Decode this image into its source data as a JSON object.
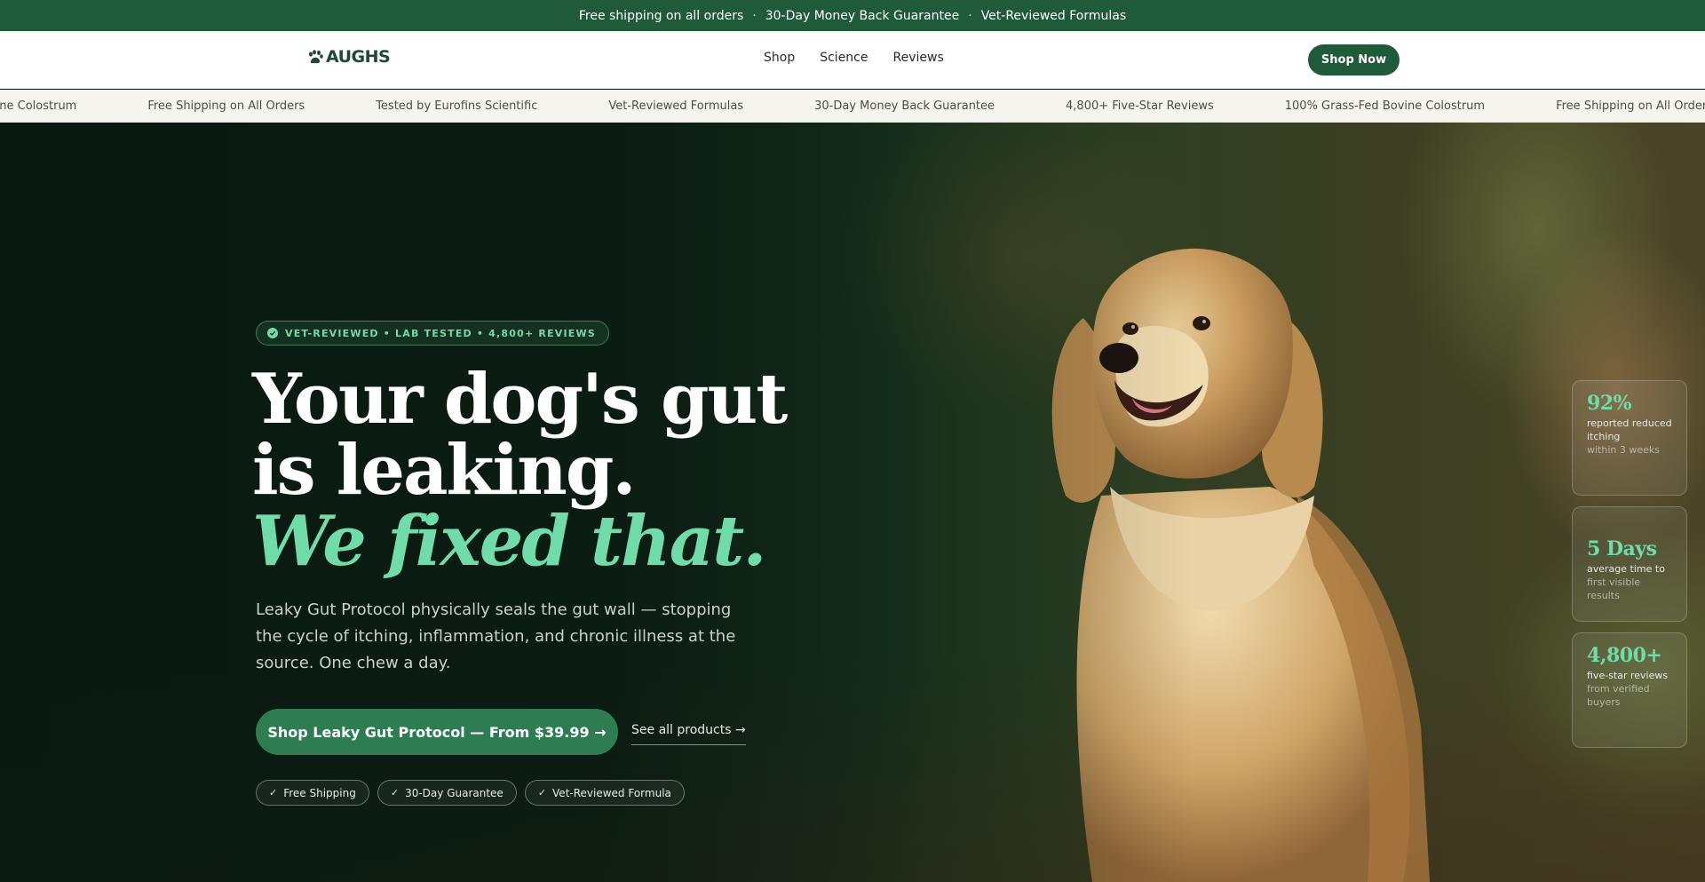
{
  "announcement": {
    "items": [
      "Free shipping on all orders",
      "30-Day Money Back Guarantee",
      "Vet-Reviewed Formulas"
    ],
    "separator": "·"
  },
  "header": {
    "logo_text": "AUGHS",
    "logo_icon": "paw-icon",
    "nav": [
      "Shop",
      "Science",
      "Reviews"
    ],
    "cta_label": "Shop Now"
  },
  "marquee": {
    "items": [
      "ovine Colostrum",
      "Free Shipping on All Orders",
      "Tested by Eurofins Scientific",
      "Vet-Reviewed Formulas",
      "30-Day Money Back Guarantee",
      "4,800+ Five-Star Reviews",
      "100% Grass-Fed Bovine Colostrum",
      "Free Shipping on All Orders"
    ]
  },
  "hero": {
    "badge": "VET-REVIEWED • LAB TESTED • 4,800+ REVIEWS",
    "headline_line1": "Your dog's gut",
    "headline_line2": "is leaking.",
    "headline_line3": "We fixed that.",
    "subcopy": "Leaky Gut Protocol physically seals the gut wall — stopping the cycle of itching, inflammation, and chronic illness at the source. One chew a day.",
    "cta_label": "Shop Leaky Gut Protocol — From $39.99 →",
    "secondary_link": "See all products →",
    "pills": [
      "Free Shipping",
      "30-Day Guarantee",
      "Vet-Reviewed Formula"
    ],
    "colors": {
      "brand": "#1f5a3a",
      "accent": "#6fdcaa",
      "cta": "#2e7d52"
    }
  },
  "stats": [
    {
      "value": "92%",
      "line1": "reported reduced itching",
      "line2": "within 3 weeks"
    },
    {
      "value": "5 Days",
      "line1": "average time to",
      "line2": "first visible results"
    },
    {
      "value": "4,800+",
      "line1": "five-star reviews",
      "line2": "from verified buyers"
    }
  ]
}
